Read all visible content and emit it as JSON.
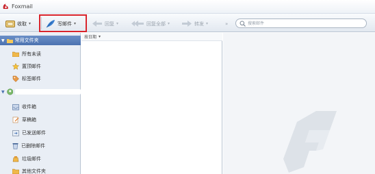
{
  "window": {
    "title": "Foxmail"
  },
  "toolbar": {
    "receive_label": "收取",
    "compose_label": "写邮件",
    "reply_label": "回复",
    "reply_all_label": "回复全部",
    "forward_label": "转发",
    "more_label": "»"
  },
  "search": {
    "placeholder": "搜索邮件"
  },
  "sidebar": {
    "common_header": "常用文件夹",
    "common_folders": [
      {
        "label": "所有未读",
        "icon": "folder-icon"
      },
      {
        "label": "置顶邮件",
        "icon": "star-icon"
      },
      {
        "label": "标签邮件",
        "icon": "tag-icon"
      }
    ],
    "account_folders": [
      {
        "label": "收件箱",
        "icon": "inbox-icon"
      },
      {
        "label": "草稿箱",
        "icon": "draft-icon"
      },
      {
        "label": "已发送邮件",
        "icon": "sent-icon"
      },
      {
        "label": "已删除邮件",
        "icon": "trash-icon"
      },
      {
        "label": "垃圾邮件",
        "icon": "spam-icon"
      },
      {
        "label": "其他文件夹",
        "icon": "folder-icon"
      }
    ]
  },
  "message_list": {
    "sort_label": "按日期"
  },
  "colors": {
    "accent": "#4b72b0",
    "highlight_box": "#d9242c",
    "brand_red": "#c8242c"
  }
}
